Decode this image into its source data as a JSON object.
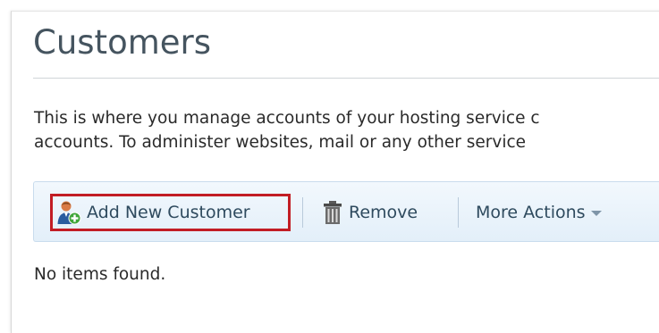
{
  "page": {
    "title": "Customers",
    "description_lines": [
      "This is where you manage accounts of your hosting service c",
      "accounts. To administer websites, mail or any other service"
    ]
  },
  "toolbar": {
    "add_label": "Add New Customer",
    "remove_label": "Remove",
    "more_label": "More Actions",
    "add_icon": "add-user-icon",
    "remove_icon": "trash-icon",
    "more_icon": "chevron-down-icon",
    "highlight_color": "#c21d24"
  },
  "list": {
    "empty_message": "No items found."
  }
}
